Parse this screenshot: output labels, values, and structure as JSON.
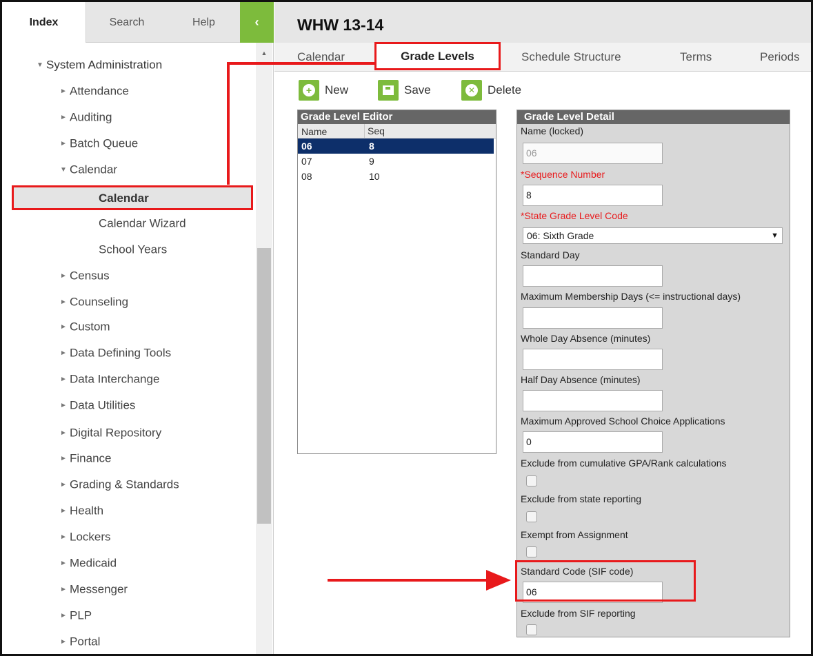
{
  "left_panel": {
    "tabs": {
      "index": "Index",
      "search": "Search",
      "help": "Help"
    },
    "collapse_glyph": "‹",
    "tree": {
      "root": "System Administration",
      "items": [
        {
          "label": "Attendance",
          "expanded": false
        },
        {
          "label": "Auditing",
          "expanded": false
        },
        {
          "label": "Batch Queue",
          "expanded": false
        },
        {
          "label": "Calendar",
          "expanded": true
        },
        {
          "label": "Census",
          "expanded": false
        },
        {
          "label": "Counseling",
          "expanded": false
        },
        {
          "label": "Custom",
          "expanded": false
        },
        {
          "label": "Data Defining Tools",
          "expanded": false
        },
        {
          "label": "Data Interchange",
          "expanded": false
        },
        {
          "label": "Data Utilities",
          "expanded": false
        },
        {
          "label": "Digital Repository",
          "expanded": false
        },
        {
          "label": "Finance",
          "expanded": false
        },
        {
          "label": "Grading & Standards",
          "expanded": false
        },
        {
          "label": "Health",
          "expanded": false
        },
        {
          "label": "Lockers",
          "expanded": false
        },
        {
          "label": "Medicaid",
          "expanded": false
        },
        {
          "label": "Messenger",
          "expanded": false
        },
        {
          "label": "PLP",
          "expanded": false
        },
        {
          "label": "Portal",
          "expanded": false
        }
      ],
      "calendar_children": [
        "Calendar",
        "Calendar Wizard",
        "School Years"
      ],
      "selected": "Calendar"
    }
  },
  "header": {
    "title": "WHW 13-14"
  },
  "subtabs": {
    "calendar": "Calendar",
    "grade_levels": "Grade Levels",
    "schedule_structure": "Schedule Structure",
    "terms": "Terms",
    "periods": "Periods",
    "active": "Grade Levels"
  },
  "toolbar": {
    "new": "New",
    "save": "Save",
    "delete": "Delete"
  },
  "editor": {
    "title": "Grade Level Editor",
    "columns": [
      "Name",
      "Seq"
    ],
    "rows": [
      {
        "name": "06",
        "seq": "8",
        "selected": true
      },
      {
        "name": "07",
        "seq": "9",
        "selected": false
      },
      {
        "name": "08",
        "seq": "10",
        "selected": false
      }
    ]
  },
  "detail": {
    "title": "Grade Level Detail",
    "name_label": "Name (locked)",
    "name_value": "06",
    "seq_label": "*Sequence Number",
    "seq_value": "8",
    "state_code_label": "*State Grade Level Code",
    "state_code_value": "06: Sixth Grade",
    "standard_day_label": "Standard Day",
    "standard_day_value": "",
    "max_membership_label": "Maximum Membership Days (<= instructional days)",
    "max_membership_value": "",
    "whole_day_label": "Whole Day Absence (minutes)",
    "whole_day_value": "",
    "half_day_label": "Half Day Absence (minutes)",
    "half_day_value": "",
    "max_choice_label": "Maximum Approved School Choice Applications",
    "max_choice_value": "0",
    "exclude_gpa_label": "Exclude from cumulative GPA/Rank calculations",
    "exclude_state_label": "Exclude from state reporting",
    "exempt_label": "Exempt from Assignment",
    "sif_label": "Standard Code (SIF code)",
    "sif_value": "06",
    "exclude_sif_label": "Exclude from SIF reporting"
  },
  "colors": {
    "accent_green": "#7dbb3c",
    "highlight_red": "#e8191b",
    "selected_row": "#0d2f6a",
    "detail_bg": "#d8d8d8"
  }
}
